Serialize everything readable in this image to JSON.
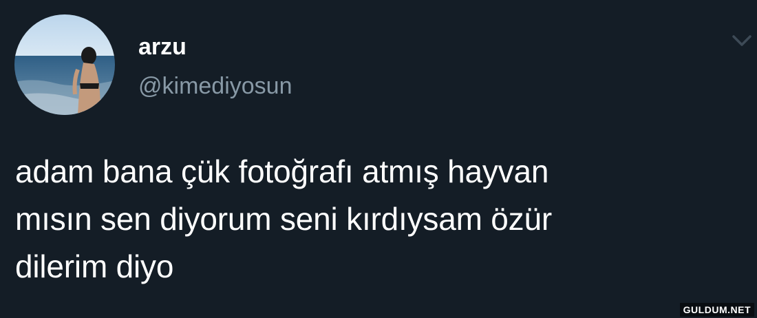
{
  "tweet": {
    "display_name": "arzu",
    "handle": "@kimediyosun",
    "text": "adam bana çük fotoğrafı atmış hayvan\nmısın sen diyorum seni kırdıysam özür\ndilerim diyo",
    "menu_icon": "chevron-down-icon",
    "avatar": "profile-photo"
  },
  "watermark": "GULDUM.NET",
  "colors": {
    "background": "#141d26",
    "primary_text": "#ffffff",
    "secondary_text": "#8899a6"
  }
}
